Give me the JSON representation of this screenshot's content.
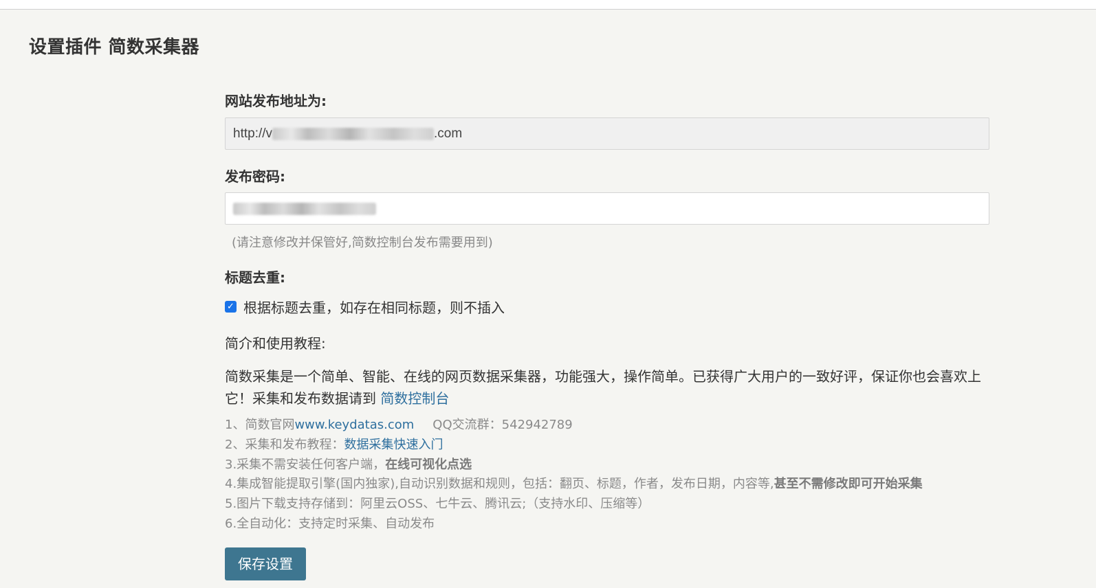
{
  "page": {
    "title": "设置插件 简数采集器"
  },
  "form": {
    "url_label": "网站发布地址为:",
    "url_prefix": "http://v",
    "url_suffix": ".com",
    "password_label": "发布密码:",
    "password_hint": "(请注意修改并保管好,简数控制台发布需要用到)",
    "dedupe_label": "标题去重:",
    "dedupe_checkbox_label": "根据标题去重，如存在相同标题，则不插入",
    "dedupe_checked": true,
    "intro_heading": "简介和使用教程:",
    "intro_text": "简数采集是一个简单、智能、在线的网页数据采集器，功能强大，操作简单。已获得广大用户的一致好评，保证你也会喜欢上它！采集和发布数据请到",
    "intro_link": "简数控制台",
    "save_button": "保存设置"
  },
  "tips": {
    "item1_prefix": "1、简数官网",
    "item1_link": "www.keydatas.com",
    "item1_qq": "QQ交流群：542942789",
    "item2_prefix": "2、采集和发布教程：",
    "item2_link": "数据采集快速入门",
    "item3_prefix": "3.采集不需安装任何客户端，",
    "item3_bold": "在线可视化点选",
    "item4_prefix": "4.集成智能提取引擎(国内独家),自动识别数据和规则，包括：翻页、标题，作者，发布日期，内容等,",
    "item4_bold": "甚至不需修改即可开始采集",
    "item5": "5.图片下载支持存储到：阿里云OSS、七牛云、腾讯云;（支持水印、压缩等）",
    "item6": "6.全自动化：支持定时采集、自动发布"
  },
  "colors": {
    "link": "#2e6f9e",
    "button": "#3e7690",
    "checkbox": "#1a73e8"
  }
}
